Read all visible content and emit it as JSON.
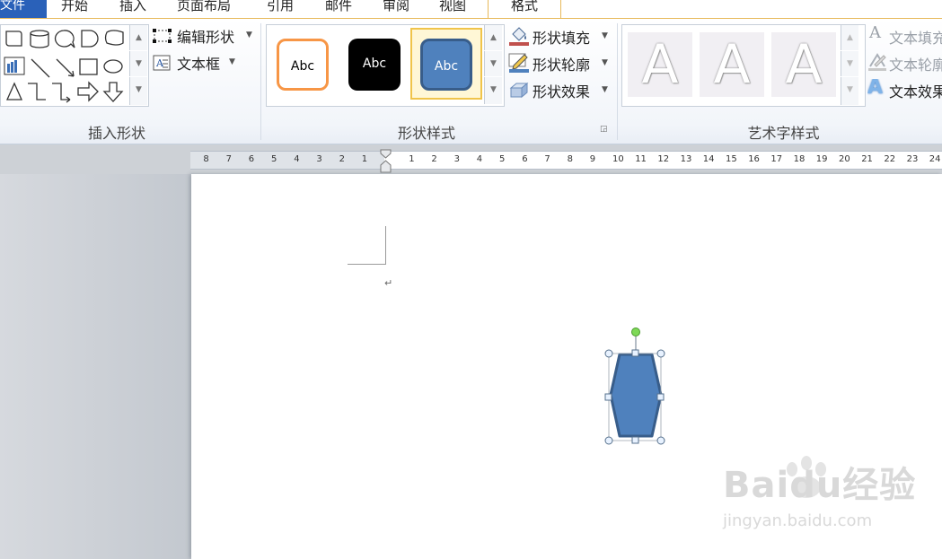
{
  "tabs": {
    "file": "文件",
    "home": "开始",
    "insert": "插入",
    "layout": "页面布局",
    "references": "引用",
    "mailings": "邮件",
    "review": "审阅",
    "view": "视图",
    "format": "格式"
  },
  "insert_shapes": {
    "edit_shape": "编辑形状",
    "text_box": "文本框",
    "group_label": "插入形状"
  },
  "shape_styles": {
    "presets": [
      "Abc",
      "Abc",
      "Abc"
    ],
    "selected_index": 2,
    "fill": "形状填充",
    "outline": "形状轮廓",
    "effects": "形状效果",
    "group_label": "形状样式"
  },
  "wordart": {
    "letters": [
      "A",
      "A",
      "A"
    ],
    "text_fill": "文本填充",
    "text_outline": "文本轮廓",
    "text_effects": "文本效果",
    "group_label": "艺术字样式"
  },
  "ruler": {
    "left_numbers": [
      "8",
      "7",
      "6",
      "5",
      "4",
      "3",
      "2",
      "1"
    ],
    "right_numbers": [
      "1",
      "2",
      "3",
      "4",
      "5",
      "6",
      "7",
      "8",
      "9",
      "10",
      "11",
      "12",
      "13",
      "14",
      "15",
      "16",
      "17",
      "18",
      "19",
      "20",
      "21",
      "22",
      "23",
      "24"
    ]
  },
  "document": {
    "paragraph_mark": "↵"
  },
  "watermark": {
    "brand": "Baidu经验",
    "url": "jingyan.baidu.com"
  },
  "colors": {
    "accent": "#2a61b9",
    "shape_fill": "#4f81bd",
    "shape_stroke": "#385d8a",
    "orange_style": "#f79646",
    "rotation_handle": "#7ed957"
  }
}
